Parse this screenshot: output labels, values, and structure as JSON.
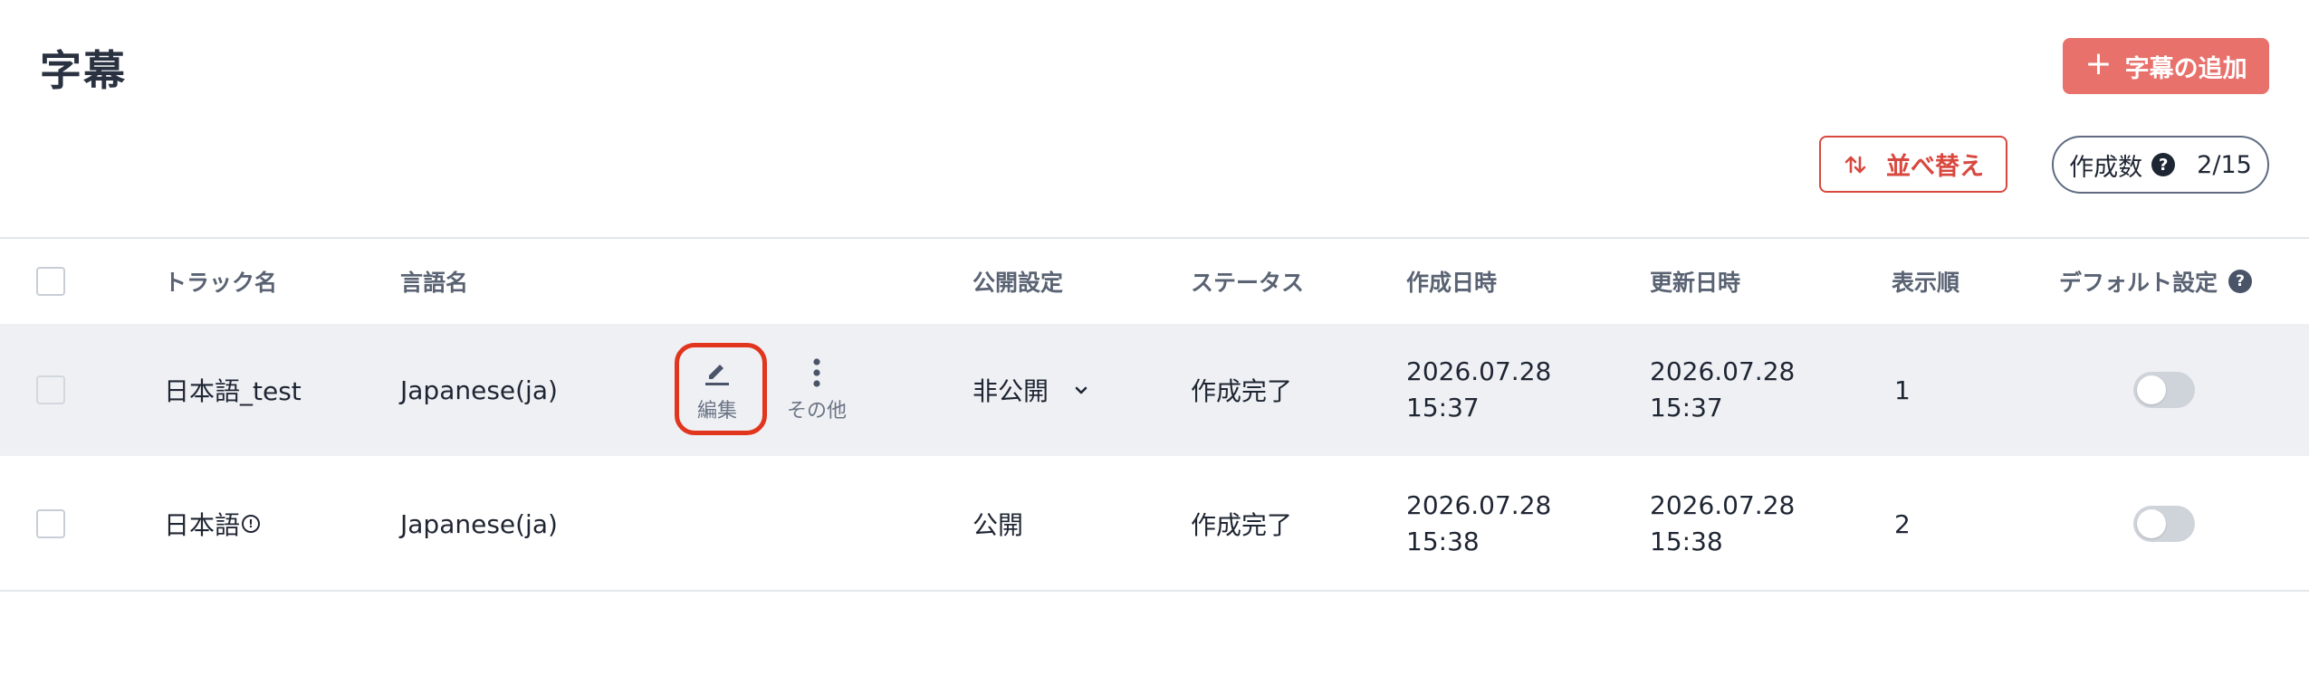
{
  "header": {
    "title": "字幕",
    "add_button_label": "字幕の追加",
    "sort_button_label": "並べ替え",
    "count_label": "作成数",
    "count_value": "2/15"
  },
  "table": {
    "columns": {
      "track_name": "トラック名",
      "language": "言語名",
      "visibility": "公開設定",
      "status": "ステータス",
      "created": "作成日時",
      "updated": "更新日時",
      "order": "表示順",
      "default": "デフォルト設定"
    },
    "actions": {
      "edit_label": "編集",
      "more_label": "その他"
    },
    "rows": [
      {
        "track_name": "日本語_test",
        "language": "Japanese(ja)",
        "visibility": "非公開",
        "status": "作成完了",
        "created_date": "2026.07.28",
        "created_time": "15:37",
        "updated_date": "2026.07.28",
        "updated_time": "15:37",
        "order": "1",
        "default_on": false
      },
      {
        "track_name": "日本語",
        "language": "Japanese(ja)",
        "visibility": "公開",
        "status": "作成完了",
        "created_date": "2026.07.28",
        "created_time": "15:38",
        "updated_date": "2026.07.28",
        "updated_time": "15:38",
        "order": "2",
        "default_on": false
      }
    ]
  },
  "colors": {
    "accent": "#e8716b",
    "accent_dark": "#d8483f",
    "highlight": "#e2351e",
    "row_hover_bg": "#eef0f4"
  }
}
